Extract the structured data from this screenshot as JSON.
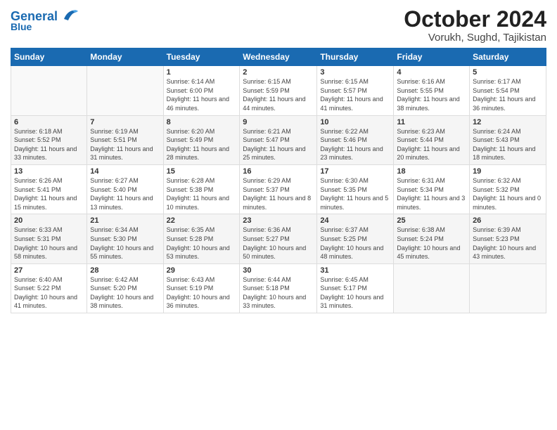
{
  "logo": {
    "text_general": "General",
    "text_blue": "Blue"
  },
  "title": "October 2024",
  "subtitle": "Vorukh, Sughd, Tajikistan",
  "weekdays": [
    "Sunday",
    "Monday",
    "Tuesday",
    "Wednesday",
    "Thursday",
    "Friday",
    "Saturday"
  ],
  "weeks": [
    [
      {
        "day": "",
        "sunrise": "",
        "sunset": "",
        "daylight": ""
      },
      {
        "day": "",
        "sunrise": "",
        "sunset": "",
        "daylight": ""
      },
      {
        "day": "1",
        "sunrise": "Sunrise: 6:14 AM",
        "sunset": "Sunset: 6:00 PM",
        "daylight": "Daylight: 11 hours and 46 minutes."
      },
      {
        "day": "2",
        "sunrise": "Sunrise: 6:15 AM",
        "sunset": "Sunset: 5:59 PM",
        "daylight": "Daylight: 11 hours and 44 minutes."
      },
      {
        "day": "3",
        "sunrise": "Sunrise: 6:15 AM",
        "sunset": "Sunset: 5:57 PM",
        "daylight": "Daylight: 11 hours and 41 minutes."
      },
      {
        "day": "4",
        "sunrise": "Sunrise: 6:16 AM",
        "sunset": "Sunset: 5:55 PM",
        "daylight": "Daylight: 11 hours and 38 minutes."
      },
      {
        "day": "5",
        "sunrise": "Sunrise: 6:17 AM",
        "sunset": "Sunset: 5:54 PM",
        "daylight": "Daylight: 11 hours and 36 minutes."
      }
    ],
    [
      {
        "day": "6",
        "sunrise": "Sunrise: 6:18 AM",
        "sunset": "Sunset: 5:52 PM",
        "daylight": "Daylight: 11 hours and 33 minutes."
      },
      {
        "day": "7",
        "sunrise": "Sunrise: 6:19 AM",
        "sunset": "Sunset: 5:51 PM",
        "daylight": "Daylight: 11 hours and 31 minutes."
      },
      {
        "day": "8",
        "sunrise": "Sunrise: 6:20 AM",
        "sunset": "Sunset: 5:49 PM",
        "daylight": "Daylight: 11 hours and 28 minutes."
      },
      {
        "day": "9",
        "sunrise": "Sunrise: 6:21 AM",
        "sunset": "Sunset: 5:47 PM",
        "daylight": "Daylight: 11 hours and 25 minutes."
      },
      {
        "day": "10",
        "sunrise": "Sunrise: 6:22 AM",
        "sunset": "Sunset: 5:46 PM",
        "daylight": "Daylight: 11 hours and 23 minutes."
      },
      {
        "day": "11",
        "sunrise": "Sunrise: 6:23 AM",
        "sunset": "Sunset: 5:44 PM",
        "daylight": "Daylight: 11 hours and 20 minutes."
      },
      {
        "day": "12",
        "sunrise": "Sunrise: 6:24 AM",
        "sunset": "Sunset: 5:43 PM",
        "daylight": "Daylight: 11 hours and 18 minutes."
      }
    ],
    [
      {
        "day": "13",
        "sunrise": "Sunrise: 6:26 AM",
        "sunset": "Sunset: 5:41 PM",
        "daylight": "Daylight: 11 hours and 15 minutes."
      },
      {
        "day": "14",
        "sunrise": "Sunrise: 6:27 AM",
        "sunset": "Sunset: 5:40 PM",
        "daylight": "Daylight: 11 hours and 13 minutes."
      },
      {
        "day": "15",
        "sunrise": "Sunrise: 6:28 AM",
        "sunset": "Sunset: 5:38 PM",
        "daylight": "Daylight: 11 hours and 10 minutes."
      },
      {
        "day": "16",
        "sunrise": "Sunrise: 6:29 AM",
        "sunset": "Sunset: 5:37 PM",
        "daylight": "Daylight: 11 hours and 8 minutes."
      },
      {
        "day": "17",
        "sunrise": "Sunrise: 6:30 AM",
        "sunset": "Sunset: 5:35 PM",
        "daylight": "Daylight: 11 hours and 5 minutes."
      },
      {
        "day": "18",
        "sunrise": "Sunrise: 6:31 AM",
        "sunset": "Sunset: 5:34 PM",
        "daylight": "Daylight: 11 hours and 3 minutes."
      },
      {
        "day": "19",
        "sunrise": "Sunrise: 6:32 AM",
        "sunset": "Sunset: 5:32 PM",
        "daylight": "Daylight: 11 hours and 0 minutes."
      }
    ],
    [
      {
        "day": "20",
        "sunrise": "Sunrise: 6:33 AM",
        "sunset": "Sunset: 5:31 PM",
        "daylight": "Daylight: 10 hours and 58 minutes."
      },
      {
        "day": "21",
        "sunrise": "Sunrise: 6:34 AM",
        "sunset": "Sunset: 5:30 PM",
        "daylight": "Daylight: 10 hours and 55 minutes."
      },
      {
        "day": "22",
        "sunrise": "Sunrise: 6:35 AM",
        "sunset": "Sunset: 5:28 PM",
        "daylight": "Daylight: 10 hours and 53 minutes."
      },
      {
        "day": "23",
        "sunrise": "Sunrise: 6:36 AM",
        "sunset": "Sunset: 5:27 PM",
        "daylight": "Daylight: 10 hours and 50 minutes."
      },
      {
        "day": "24",
        "sunrise": "Sunrise: 6:37 AM",
        "sunset": "Sunset: 5:25 PM",
        "daylight": "Daylight: 10 hours and 48 minutes."
      },
      {
        "day": "25",
        "sunrise": "Sunrise: 6:38 AM",
        "sunset": "Sunset: 5:24 PM",
        "daylight": "Daylight: 10 hours and 45 minutes."
      },
      {
        "day": "26",
        "sunrise": "Sunrise: 6:39 AM",
        "sunset": "Sunset: 5:23 PM",
        "daylight": "Daylight: 10 hours and 43 minutes."
      }
    ],
    [
      {
        "day": "27",
        "sunrise": "Sunrise: 6:40 AM",
        "sunset": "Sunset: 5:22 PM",
        "daylight": "Daylight: 10 hours and 41 minutes."
      },
      {
        "day": "28",
        "sunrise": "Sunrise: 6:42 AM",
        "sunset": "Sunset: 5:20 PM",
        "daylight": "Daylight: 10 hours and 38 minutes."
      },
      {
        "day": "29",
        "sunrise": "Sunrise: 6:43 AM",
        "sunset": "Sunset: 5:19 PM",
        "daylight": "Daylight: 10 hours and 36 minutes."
      },
      {
        "day": "30",
        "sunrise": "Sunrise: 6:44 AM",
        "sunset": "Sunset: 5:18 PM",
        "daylight": "Daylight: 10 hours and 33 minutes."
      },
      {
        "day": "31",
        "sunrise": "Sunrise: 6:45 AM",
        "sunset": "Sunset: 5:17 PM",
        "daylight": "Daylight: 10 hours and 31 minutes."
      },
      {
        "day": "",
        "sunrise": "",
        "sunset": "",
        "daylight": ""
      },
      {
        "day": "",
        "sunrise": "",
        "sunset": "",
        "daylight": ""
      }
    ]
  ]
}
